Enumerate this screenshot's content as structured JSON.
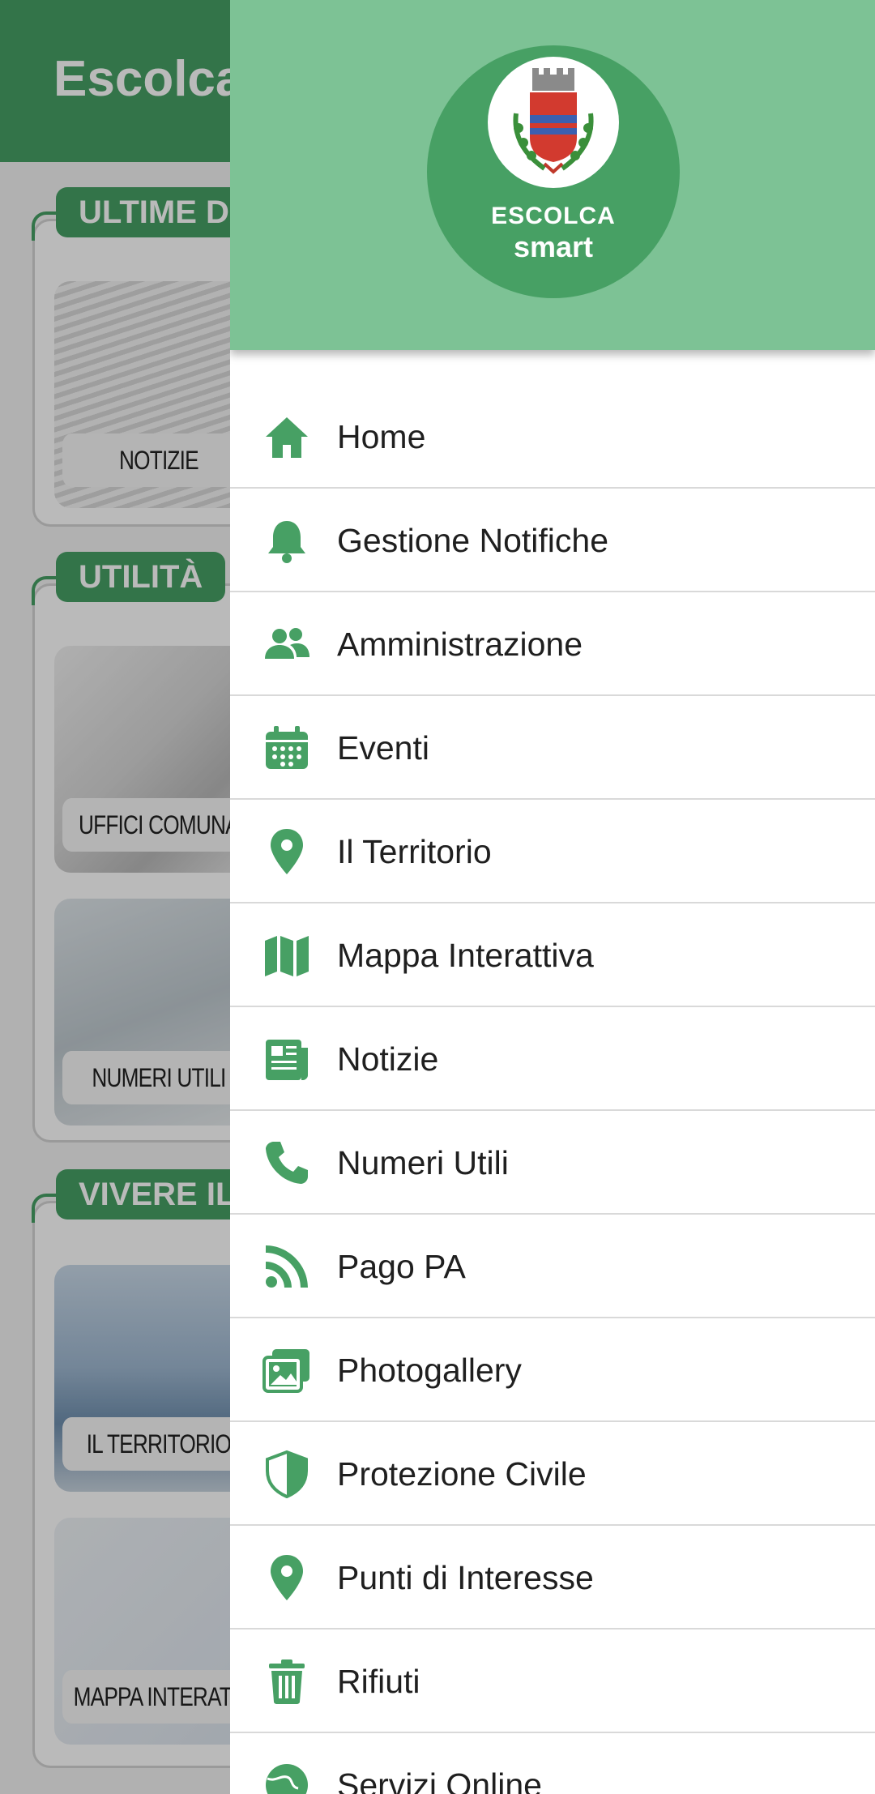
{
  "background": {
    "app_title": "Escolca",
    "sections": [
      {
        "label": "ULTIME DA"
      },
      {
        "label": "UTILITÀ"
      },
      {
        "label": "VIVERE IL"
      }
    ],
    "tiles": [
      {
        "label": "NOTIZIE"
      },
      {
        "label": "UFFICI COMUNA"
      },
      {
        "label": "NUMERI UTILI"
      },
      {
        "label": "IL TERRITORIO"
      },
      {
        "label": "MAPPA INTERATT"
      }
    ]
  },
  "drawer": {
    "logo": {
      "line1": "ESCOLCA",
      "line2": "smart"
    },
    "accent_color": "#47a064",
    "header_color": "#7dc295",
    "items": [
      {
        "label": "Home",
        "icon": "home-icon"
      },
      {
        "label": "Gestione Notifiche",
        "icon": "bell-icon"
      },
      {
        "label": "Amministrazione",
        "icon": "users-icon"
      },
      {
        "label": "Eventi",
        "icon": "calendar-icon"
      },
      {
        "label": "Il Territorio",
        "icon": "map-pin-icon"
      },
      {
        "label": "Mappa Interattiva",
        "icon": "map-icon"
      },
      {
        "label": "Notizie",
        "icon": "newspaper-icon"
      },
      {
        "label": "Numeri Utili",
        "icon": "phone-icon"
      },
      {
        "label": "Pago PA",
        "icon": "rss-icon"
      },
      {
        "label": "Photogallery",
        "icon": "images-icon"
      },
      {
        "label": "Protezione Civile",
        "icon": "shield-icon"
      },
      {
        "label": "Punti di Interesse",
        "icon": "map-pin-icon"
      },
      {
        "label": "Rifiuti",
        "icon": "trash-icon"
      },
      {
        "label": "Servizi Online",
        "icon": "globe-icon"
      }
    ]
  }
}
